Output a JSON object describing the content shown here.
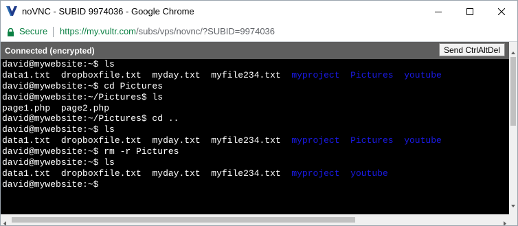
{
  "window": {
    "title": "noVNC - SUBID 9974036 - Google Chrome",
    "icon": "vultr-v-icon",
    "controls": [
      "minimize-icon",
      "maximize-icon",
      "close-icon"
    ]
  },
  "address_bar": {
    "secure_label": "Secure",
    "url_domain": "https://my.vultr.com",
    "url_path": "/subs/vps/novnc/?SUBID=9974036",
    "secure_color": "#0b8043"
  },
  "novnc": {
    "status_text": "Connected (encrypted)",
    "ctrl_alt_del_label": "Send CtrlAltDel",
    "status_bar_color": "#5e5e5e"
  },
  "terminal": {
    "dir_color": "#1a1ae6",
    "lines": [
      {
        "segments": [
          {
            "text": "david@mywebsite:~$ ls",
            "type": "plain"
          }
        ]
      },
      {
        "segments": [
          {
            "text": "data1.txt",
            "type": "file"
          },
          {
            "text": "dropboxfile.txt",
            "type": "file"
          },
          {
            "text": "myday.txt",
            "type": "file"
          },
          {
            "text": "myfile234.txt",
            "type": "file"
          },
          {
            "text": "myproject",
            "type": "dir"
          },
          {
            "text": "Pictures",
            "type": "dir"
          },
          {
            "text": "youtube",
            "type": "dir"
          }
        ]
      },
      {
        "segments": [
          {
            "text": "david@mywebsite:~$ cd Pictures",
            "type": "plain"
          }
        ]
      },
      {
        "segments": [
          {
            "text": "david@mywebsite:~/Pictures$ ls",
            "type": "plain"
          }
        ]
      },
      {
        "segments": [
          {
            "text": "page1.php",
            "type": "file"
          },
          {
            "text": "page2.php",
            "type": "file"
          }
        ]
      },
      {
        "segments": [
          {
            "text": "david@mywebsite:~/Pictures$ cd ..",
            "type": "plain"
          }
        ]
      },
      {
        "segments": [
          {
            "text": "david@mywebsite:~$ ls",
            "type": "plain"
          }
        ]
      },
      {
        "segments": [
          {
            "text": "data1.txt",
            "type": "file"
          },
          {
            "text": "dropboxfile.txt",
            "type": "file"
          },
          {
            "text": "myday.txt",
            "type": "file"
          },
          {
            "text": "myfile234.txt",
            "type": "file"
          },
          {
            "text": "myproject",
            "type": "dir"
          },
          {
            "text": "Pictures",
            "type": "dir"
          },
          {
            "text": "youtube",
            "type": "dir"
          }
        ]
      },
      {
        "segments": [
          {
            "text": "david@mywebsite:~$ rm -r Pictures",
            "type": "plain"
          }
        ]
      },
      {
        "segments": [
          {
            "text": "david@mywebsite:~$ ls",
            "type": "plain"
          }
        ]
      },
      {
        "segments": [
          {
            "text": "data1.txt",
            "type": "file"
          },
          {
            "text": "dropboxfile.txt",
            "type": "file"
          },
          {
            "text": "myday.txt",
            "type": "file"
          },
          {
            "text": "myfile234.txt",
            "type": "file"
          },
          {
            "text": "myproject",
            "type": "dir"
          },
          {
            "text": "youtube",
            "type": "dir"
          }
        ]
      },
      {
        "segments": [
          {
            "text": "david@mywebsite:~$",
            "type": "plain"
          }
        ]
      }
    ]
  }
}
